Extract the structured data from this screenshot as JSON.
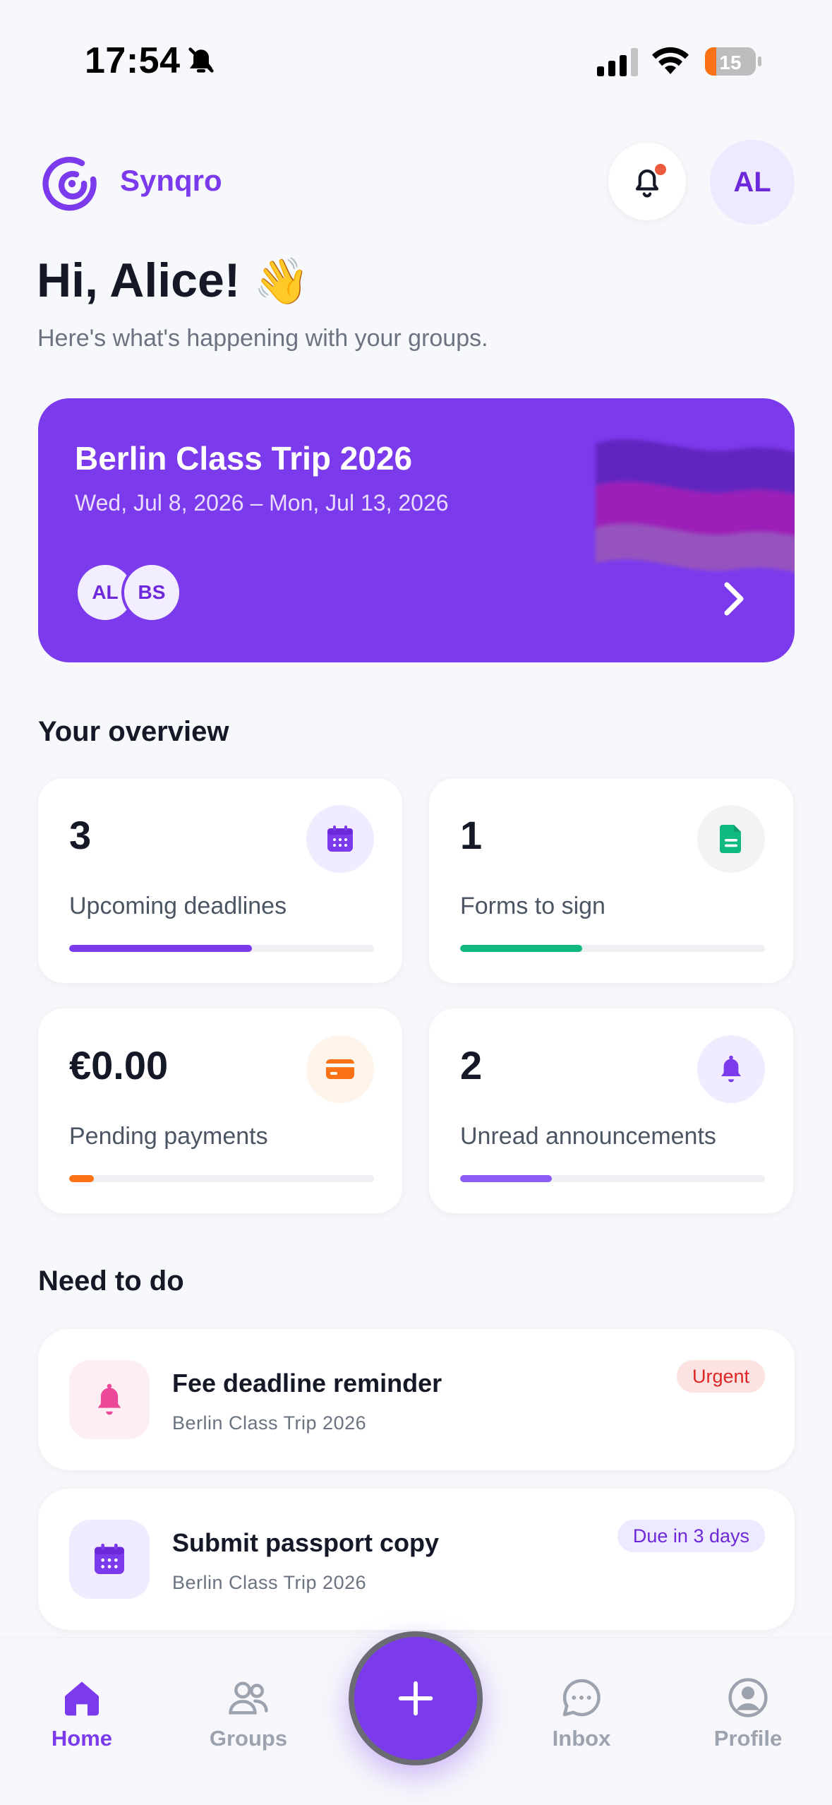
{
  "status_bar": {
    "time": "17:54",
    "battery": "15"
  },
  "header": {
    "brand": "Synqro",
    "avatar_initials": "AL"
  },
  "greeting": {
    "title": "Hi, Alice!",
    "emoji": "👋",
    "subtitle": "Here's what's happening with your groups."
  },
  "trip": {
    "title": "Berlin Class Trip 2026",
    "dates": "Wed, Jul 8, 2026 – Mon, Jul 13, 2026",
    "members": [
      "AL",
      "BS"
    ]
  },
  "overview": {
    "title": "Your overview",
    "cards": [
      {
        "value": "3",
        "label": "Upcoming deadlines",
        "progress": 0.6,
        "color": "#7c3aed",
        "icon": "calendar-icon"
      },
      {
        "value": "1",
        "label": "Forms to sign",
        "progress": 0.4,
        "color": "#10b981",
        "icon": "document-icon"
      },
      {
        "value": "€0.00",
        "label": "Pending payments",
        "progress": 0.08,
        "color": "#f97316",
        "icon": "credit-card-icon"
      },
      {
        "value": "2",
        "label": "Unread announcements",
        "progress": 0.3,
        "color": "#8b5cf6",
        "icon": "bell-icon"
      }
    ]
  },
  "todo": {
    "title": "Need to do",
    "items": [
      {
        "title": "Fee deadline reminder",
        "subtitle": "Berlin Class Trip 2026",
        "badge": "Urgent",
        "icon": "bell-icon"
      },
      {
        "title": "Submit passport copy",
        "subtitle": "Berlin Class Trip 2026",
        "badge": "Due in 3 days",
        "icon": "calendar-icon"
      }
    ]
  },
  "nav": {
    "home": "Home",
    "groups": "Groups",
    "inbox": "Inbox",
    "profile": "Profile"
  },
  "colors": {
    "accent": "#7c3aed",
    "success": "#10b981",
    "warning": "#f97316",
    "danger": "#ef4444"
  }
}
